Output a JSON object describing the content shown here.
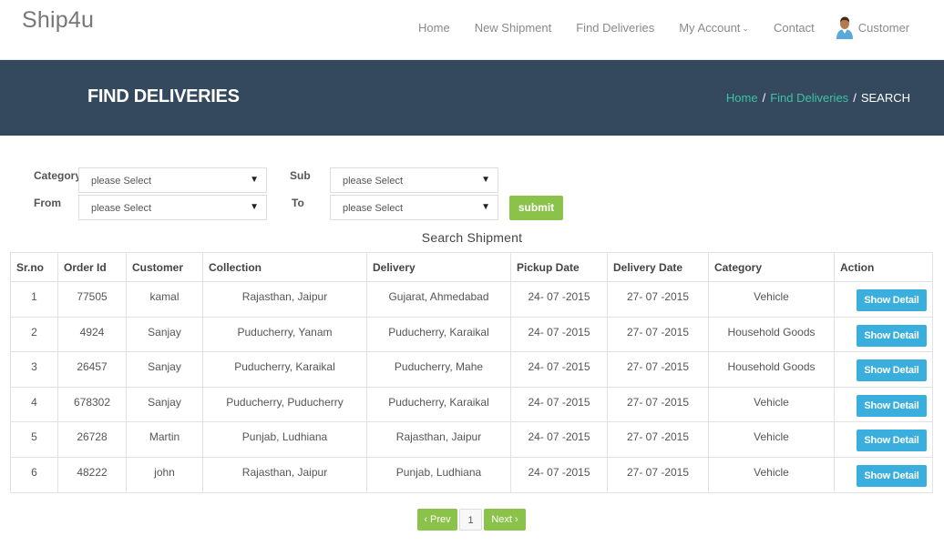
{
  "brand": "Ship4u",
  "nav": {
    "items": [
      {
        "label": "Home"
      },
      {
        "label": "New Shipment"
      },
      {
        "label": "Find Deliveries"
      },
      {
        "label": "My Account",
        "icon": "chevron-down-icon"
      },
      {
        "label": "Contact"
      }
    ],
    "user": {
      "label": "Customer",
      "icon": "user-avatar-icon"
    }
  },
  "banner": {
    "title": "FIND DELIVERIES",
    "breadcrumb": [
      {
        "label": "Home",
        "link": true
      },
      {
        "label": "Find Deliveries",
        "link": true
      },
      {
        "label": "SEARCH",
        "link": false
      }
    ],
    "separator": "/"
  },
  "filters": {
    "category": {
      "label": "Category",
      "value": "please Select"
    },
    "sub": {
      "label": "Sub",
      "value": "please Select"
    },
    "from": {
      "label": "From",
      "value": "please Select"
    },
    "to": {
      "label": "To",
      "value": "please Select"
    },
    "submit_label": "submit",
    "dropdown_icon": "▼"
  },
  "table": {
    "title": "Search Shipment",
    "columns": [
      "Sr.no",
      "Order Id",
      "Customer",
      "Collection",
      "Delivery",
      "Pickup Date",
      "Delivery Date",
      "Category",
      "Action"
    ],
    "action_label": "Show Detail",
    "rows": [
      [
        "1",
        "77505",
        "kamal",
        "Rajasthan, Jaipur",
        "Gujarat, Ahmedabad",
        "24- 07 -2015",
        "27- 07 -2015",
        "Vehicle"
      ],
      [
        "2",
        "4924",
        "Sanjay",
        "Puducherry, Yanam",
        "Puducherry, Karaikal",
        "24- 07 -2015",
        "27- 07 -2015",
        "Household Goods"
      ],
      [
        "3",
        "26457",
        "Sanjay",
        "Puducherry, Karaikal",
        "Puducherry, Mahe",
        "24- 07 -2015",
        "27- 07 -2015",
        "Household Goods"
      ],
      [
        "4",
        "678302",
        "Sanjay",
        "Puducherry, Puducherry",
        "Puducherry, Karaikal",
        "24- 07 -2015",
        "27- 07 -2015",
        "Vehicle"
      ],
      [
        "5",
        "26728",
        "Martin",
        "Punjab, Ludhiana",
        "Rajasthan, Jaipur",
        "24- 07 -2015",
        "27- 07 -2015",
        "Vehicle"
      ],
      [
        "6",
        "48222",
        "john",
        "Rajasthan, Jaipur",
        "Punjab, Ludhiana",
        "24- 07 -2015",
        "27- 07 -2015",
        "Vehicle"
      ]
    ]
  },
  "pagination": {
    "prev": "‹ Prev",
    "current": "1",
    "next": "Next ›"
  },
  "colors": {
    "banner_bg": "#34495e",
    "breadcrumb_link": "#3fc1a5",
    "submit_green": "#8bc34a",
    "detail_blue": "#3aaedc"
  }
}
